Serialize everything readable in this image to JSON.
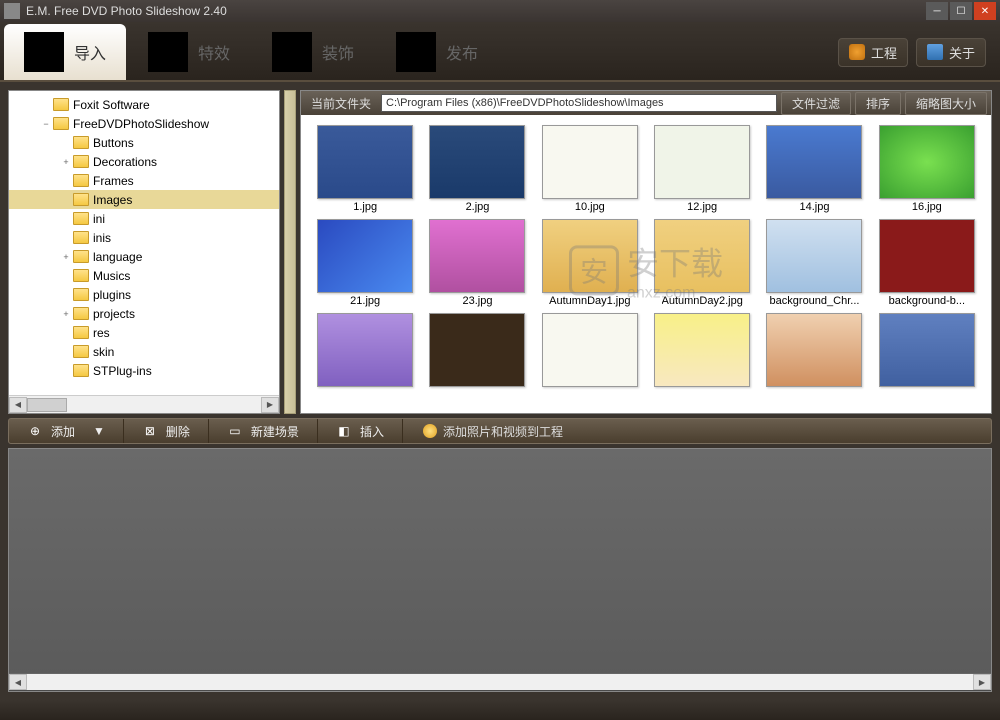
{
  "title": "E.M. Free DVD Photo Slideshow 2.40",
  "tabs": {
    "import": "导入",
    "effects": "特效",
    "decorate": "装饰",
    "publish": "发布"
  },
  "top_buttons": {
    "project": "工程",
    "about": "关于"
  },
  "tree": {
    "items": [
      {
        "label": "Foxit Software",
        "depth": 1,
        "twisty": "",
        "sel": false
      },
      {
        "label": "FreeDVDPhotoSlideshow",
        "depth": 1,
        "twisty": "−",
        "sel": false
      },
      {
        "label": "Buttons",
        "depth": 2,
        "twisty": "",
        "sel": false
      },
      {
        "label": "Decorations",
        "depth": 2,
        "twisty": "+",
        "sel": false
      },
      {
        "label": "Frames",
        "depth": 2,
        "twisty": "",
        "sel": false
      },
      {
        "label": "Images",
        "depth": 2,
        "twisty": "",
        "sel": true
      },
      {
        "label": "ini",
        "depth": 2,
        "twisty": "",
        "sel": false
      },
      {
        "label": "inis",
        "depth": 2,
        "twisty": "",
        "sel": false
      },
      {
        "label": "language",
        "depth": 2,
        "twisty": "+",
        "sel": false
      },
      {
        "label": "Musics",
        "depth": 2,
        "twisty": "",
        "sel": false
      },
      {
        "label": "plugins",
        "depth": 2,
        "twisty": "",
        "sel": false
      },
      {
        "label": "projects",
        "depth": 2,
        "twisty": "+",
        "sel": false
      },
      {
        "label": "res",
        "depth": 2,
        "twisty": "",
        "sel": false
      },
      {
        "label": "skin",
        "depth": 2,
        "twisty": "",
        "sel": false
      },
      {
        "label": "STPlug-ins",
        "depth": 2,
        "twisty": "",
        "sel": false
      }
    ]
  },
  "path_bar": {
    "label": "当前文件夹",
    "path": "C:\\Program Files (x86)\\FreeDVDPhotoSlideshow\\Images",
    "filter": "文件过滤",
    "sort": "排序",
    "size": "缩略图大小"
  },
  "thumbs": [
    {
      "name": "1.jpg",
      "bg": "linear-gradient(#3a5a9a, #2a4a8a)"
    },
    {
      "name": "2.jpg",
      "bg": "linear-gradient(#2a4a7a, #1a3a6a)"
    },
    {
      "name": "10.jpg",
      "bg": "#f8f8f0"
    },
    {
      "name": "12.jpg",
      "bg": "#f0f4e8"
    },
    {
      "name": "14.jpg",
      "bg": "linear-gradient(#4a7ad0, #3a5aa0)"
    },
    {
      "name": "16.jpg",
      "bg": "radial-gradient(#7ae050, #3aa030)"
    },
    {
      "name": "21.jpg",
      "bg": "linear-gradient(135deg, #2a4ac0, #4a8af0)"
    },
    {
      "name": "23.jpg",
      "bg": "linear-gradient(#e070d0, #b050a0)"
    },
    {
      "name": "AutumnDay1.jpg",
      "bg": "linear-gradient(#f0d080, #e0b050)"
    },
    {
      "name": "AutumnDay2.jpg",
      "bg": "linear-gradient(#f0d080, #e8c060)"
    },
    {
      "name": "background_Chr...",
      "bg": "linear-gradient(#d0e0f0, #a0c0e0)"
    },
    {
      "name": "background-b...",
      "bg": "#8a1a1a"
    },
    {
      "name": "",
      "bg": "linear-gradient(#b090e0, #8060c0)"
    },
    {
      "name": "",
      "bg": "#3a2a1a"
    },
    {
      "name": "",
      "bg": "#f8f8f0"
    },
    {
      "name": "",
      "bg": "linear-gradient(#f8f088, #f8e8c0)"
    },
    {
      "name": "",
      "bg": "linear-gradient(#f0d0b0, #d09060)"
    },
    {
      "name": "",
      "bg": "linear-gradient(#6080c0, #4060a0)"
    }
  ],
  "watermark": {
    "text": "安下载",
    "sub": "anxz.com"
  },
  "bottom_bar": {
    "add": "添加",
    "delete": "删除",
    "newscene": "新建场景",
    "insert": "插入",
    "hint": "添加照片和视频到工程"
  }
}
